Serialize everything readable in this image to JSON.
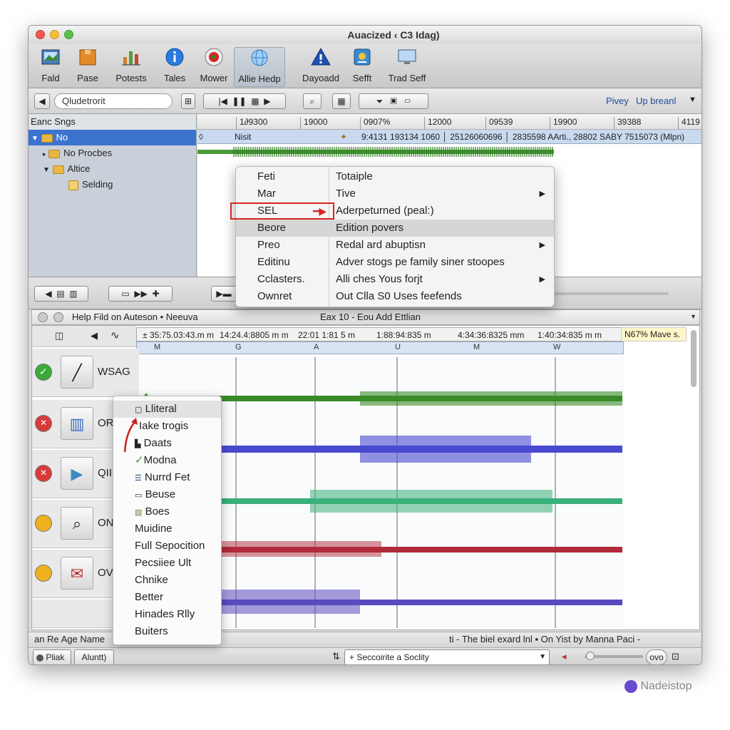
{
  "window": {
    "title": "Auacized ‹ C3 Idag)"
  },
  "toolbar": {
    "items": [
      {
        "label": "Fald",
        "icon": "picture-icon"
      },
      {
        "label": "Pase",
        "icon": "box-icon"
      },
      {
        "label": "Potests",
        "icon": "chart-icon"
      },
      {
        "label": "Tales",
        "icon": "info-icon"
      },
      {
        "label": "Mower",
        "icon": "record-icon"
      },
      {
        "label": "Allie Hedp",
        "icon": "globe-icon"
      },
      {
        "label": "Dayoadd",
        "icon": "warning-icon"
      },
      {
        "label": "Sefft",
        "icon": "app-icon"
      },
      {
        "label": "Trad Seff",
        "icon": "monitor-icon"
      }
    ]
  },
  "navbar": {
    "search_value": "Qludetrorit",
    "right_label1": "Pivey",
    "right_label2": "Up breanl"
  },
  "sidebar": {
    "header": "Eanc Sngs",
    "items": [
      {
        "label": "No"
      },
      {
        "label": "No Procbes"
      },
      {
        "label": "Altice"
      },
      {
        "label": "Selding"
      }
    ]
  },
  "upper": {
    "ruler": [
      "1∂9300",
      "19000",
      "0907%",
      "12000",
      "09539",
      "19900",
      "39388",
      "4119"
    ],
    "track_name": "Nisit",
    "track_info": "9:4131 193134 1060 │ 25126060696 │ 2835598 AArti., 28802 SABY 7515073 (Mlpn)"
  },
  "context_menu": {
    "left": [
      "Feti",
      "Mar",
      "SEL",
      "Beore",
      "Preo",
      "Editinu",
      "Cclasters.",
      "Ownret"
    ],
    "right": [
      "Totaiple",
      "Tive",
      "Aderpeturned (peal:)",
      "Edition povers",
      "Redal ard abuptisn",
      "Adver stogs pe family siner stoopes",
      "Alli ches Yous forjt",
      "Out Clla S0 Uses feefends"
    ]
  },
  "lower": {
    "title_left": "Help Fild on Auteson • Neeuva",
    "title_center": "Eax 10 - Eou Add Ettlian",
    "ruler": [
      "± 35:75.03:43.m m",
      "14:24.4:8805 m m",
      "22:01 1:81 5 m",
      "1:88:94:835 m",
      "4:34:36:8325 mm",
      "1:40:34:835 m m"
    ],
    "ruler_letters": [
      "M",
      "G",
      "A",
      "U",
      "M",
      "W"
    ],
    "ruler_right": "N67%  Mave  s.",
    "tracks": [
      {
        "name": "WSAG",
        "status": "ok"
      },
      {
        "name": "OR",
        "status": "error"
      },
      {
        "name": "QII",
        "status": "error"
      },
      {
        "name": "ON",
        "status": "warn"
      },
      {
        "name": "OV",
        "status": "warn"
      }
    ]
  },
  "popup_menu": [
    "Lliteral",
    "Iake trogis",
    "Daats",
    "Modna",
    "Nurrd Fet",
    "Beuse",
    "Boes",
    "Muidine",
    "Full Sepocition",
    "Pecsiiee Ult",
    "Chnike",
    "Better",
    "Hinades Rlly",
    "Buiters"
  ],
  "status": {
    "bar1_left": "an Re Age  Name",
    "bar1_right": "ti  - The biel exard  lnl  ▪  On Yist by Manna  Paci  -",
    "btn1": "Pliak",
    "btn2": "Aluntt)",
    "dropdown": "Seccoirite a Soclity",
    "pill": "ovo"
  },
  "watermark": "Nadeistop"
}
